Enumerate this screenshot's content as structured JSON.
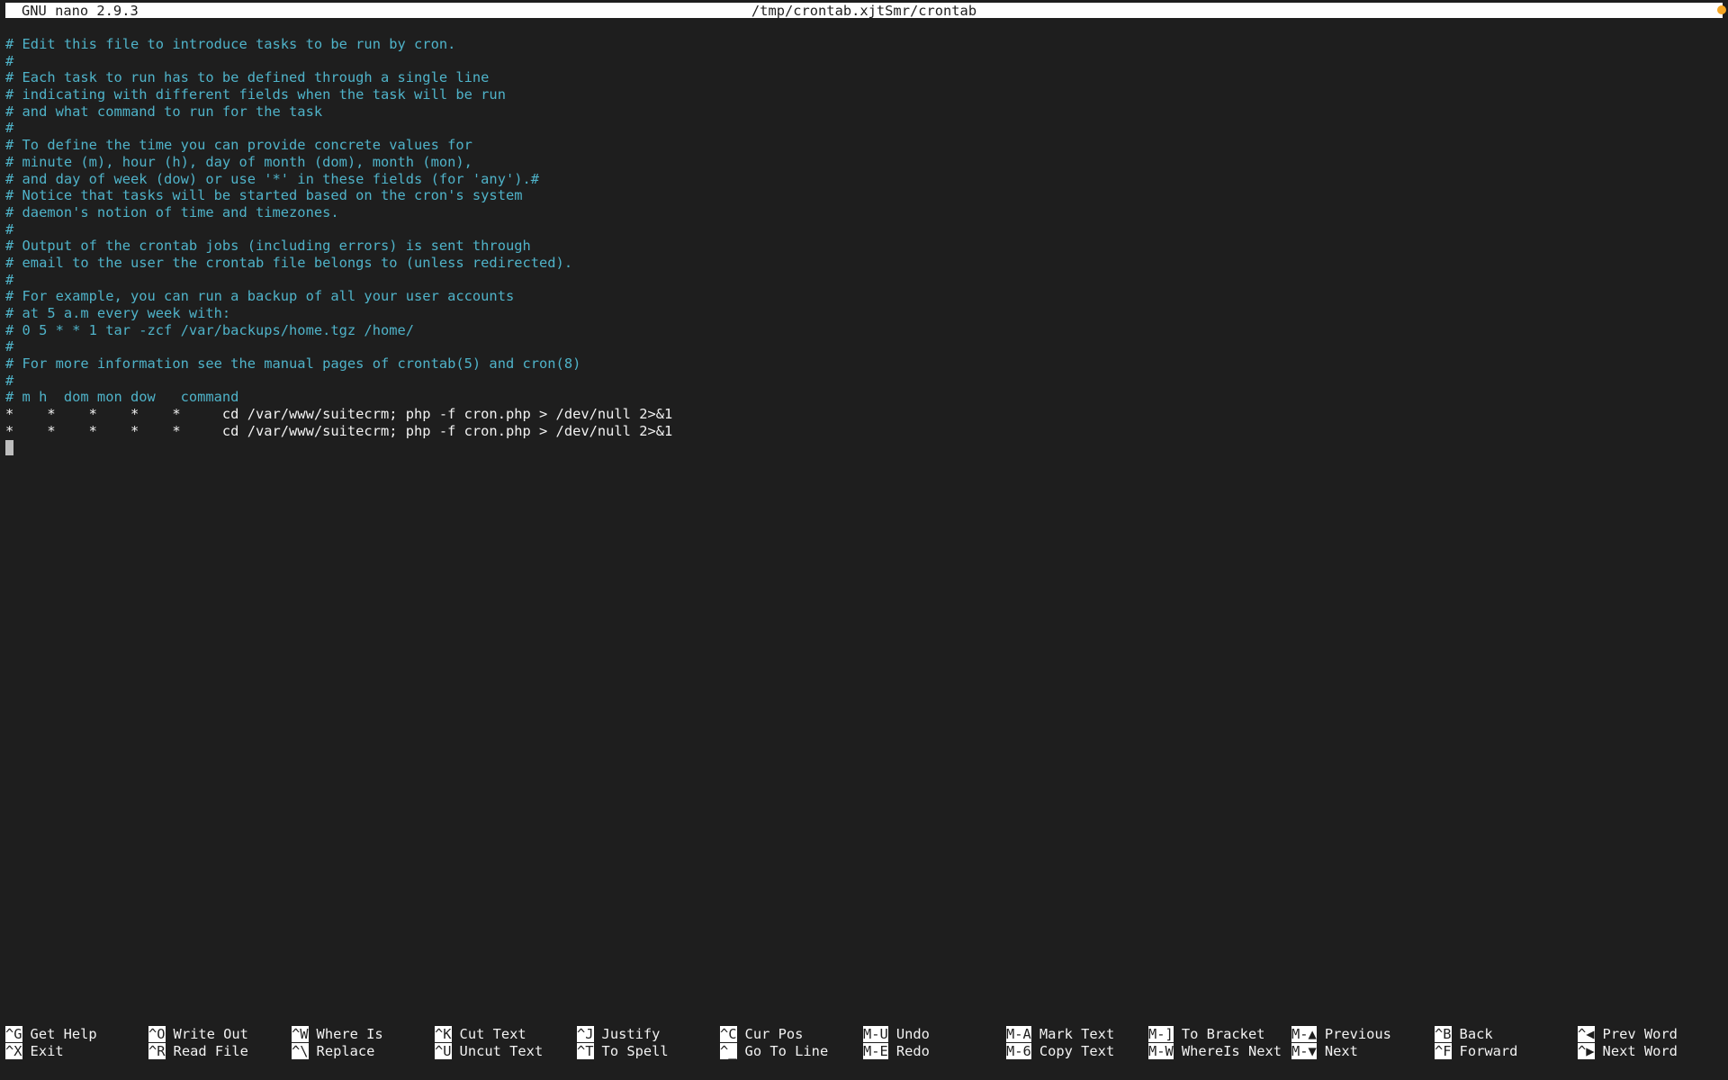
{
  "titlebar": {
    "app_version": "GNU nano 2.9.3",
    "filename": "/tmp/crontab.xjtSmr/crontab"
  },
  "editor": {
    "lines": [
      {
        "text": "# Edit this file to introduce tasks to be run by cron.",
        "kind": "comment"
      },
      {
        "text": "#",
        "kind": "comment"
      },
      {
        "text": "# Each task to run has to be defined through a single line",
        "kind": "comment"
      },
      {
        "text": "# indicating with different fields when the task will be run",
        "kind": "comment"
      },
      {
        "text": "# and what command to run for the task",
        "kind": "comment"
      },
      {
        "text": "#",
        "kind": "comment"
      },
      {
        "text": "# To define the time you can provide concrete values for",
        "kind": "comment"
      },
      {
        "text": "# minute (m), hour (h), day of month (dom), month (mon),",
        "kind": "comment"
      },
      {
        "text": "# and day of week (dow) or use '*' in these fields (for 'any').#",
        "kind": "comment"
      },
      {
        "text": "# Notice that tasks will be started based on the cron's system",
        "kind": "comment"
      },
      {
        "text": "# daemon's notion of time and timezones.",
        "kind": "comment"
      },
      {
        "text": "#",
        "kind": "comment"
      },
      {
        "text": "# Output of the crontab jobs (including errors) is sent through",
        "kind": "comment"
      },
      {
        "text": "# email to the user the crontab file belongs to (unless redirected).",
        "kind": "comment"
      },
      {
        "text": "#",
        "kind": "comment"
      },
      {
        "text": "# For example, you can run a backup of all your user accounts",
        "kind": "comment"
      },
      {
        "text": "# at 5 a.m every week with:",
        "kind": "comment"
      },
      {
        "text": "# 0 5 * * 1 tar -zcf /var/backups/home.tgz /home/",
        "kind": "comment"
      },
      {
        "text": "#",
        "kind": "comment"
      },
      {
        "text": "# For more information see the manual pages of crontab(5) and cron(8)",
        "kind": "comment"
      },
      {
        "text": "#",
        "kind": "comment"
      },
      {
        "text": "# m h  dom mon dow   command",
        "kind": "comment"
      },
      {
        "text": "*    *    *    *    *     cd /var/www/suitecrm; php -f cron.php > /dev/null 2>&1",
        "kind": "code"
      },
      {
        "text": "*    *    *    *    *     cd /var/www/suitecrm; php -f cron.php > /dev/null 2>&1",
        "kind": "code"
      }
    ]
  },
  "shortcuts": [
    {
      "key": "^G",
      "label": "Get Help"
    },
    {
      "key": "^X",
      "label": "Exit"
    },
    {
      "key": "^O",
      "label": "Write Out"
    },
    {
      "key": "^R",
      "label": "Read File"
    },
    {
      "key": "^W",
      "label": "Where Is"
    },
    {
      "key": "^\\",
      "label": "Replace"
    },
    {
      "key": "^K",
      "label": "Cut Text"
    },
    {
      "key": "^U",
      "label": "Uncut Text"
    },
    {
      "key": "^J",
      "label": "Justify"
    },
    {
      "key": "^T",
      "label": "To Spell"
    },
    {
      "key": "^C",
      "label": "Cur Pos"
    },
    {
      "key": "^_",
      "label": "Go To Line"
    },
    {
      "key": "M-U",
      "label": "Undo"
    },
    {
      "key": "M-E",
      "label": "Redo"
    },
    {
      "key": "M-A",
      "label": "Mark Text"
    },
    {
      "key": "M-6",
      "label": "Copy Text"
    },
    {
      "key": "M-]",
      "label": "To Bracket"
    },
    {
      "key": "M-W",
      "label": "WhereIs Next"
    },
    {
      "key": "M-▲",
      "label": "Previous"
    },
    {
      "key": "M-▼",
      "label": "Next"
    },
    {
      "key": "^B",
      "label": "Back"
    },
    {
      "key": "^F",
      "label": "Forward"
    },
    {
      "key": "^◀",
      "label": "Prev Word"
    },
    {
      "key": "^▶",
      "label": "Next Word"
    }
  ],
  "colors": {
    "background": "#1e1e1e",
    "comment": "#4fb3c9",
    "text": "#f2f2f2",
    "inverse": "#ffffff",
    "indicator": "#f5a623"
  }
}
